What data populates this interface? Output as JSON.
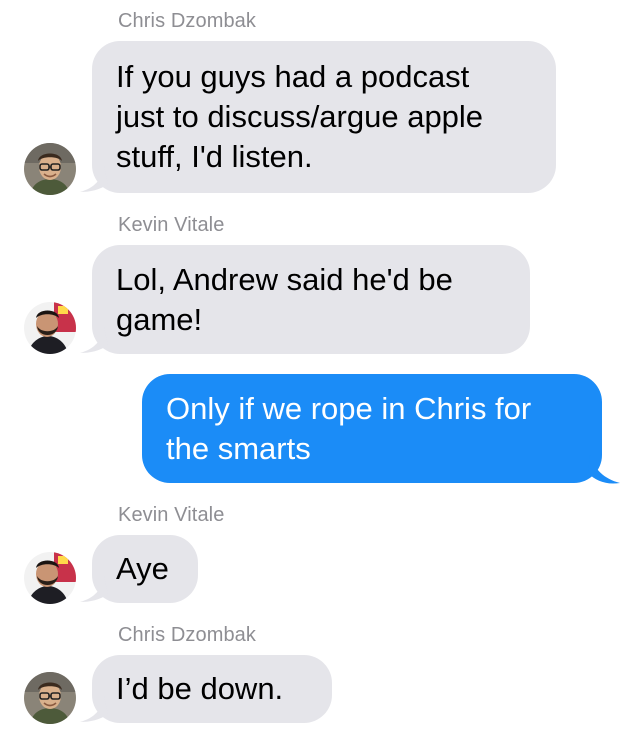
{
  "conversation": {
    "messages": [
      {
        "sender": "Chris Dzombak",
        "direction": "incoming",
        "avatar": "chris-avatar",
        "text": "If you guys had a podcast\njust to discuss/argue apple\nstuff, I'd listen."
      },
      {
        "sender": "Kevin Vitale",
        "direction": "incoming",
        "avatar": "kevin-avatar",
        "text": "Lol, Andrew said he'd be\ngame!"
      },
      {
        "sender": "",
        "direction": "outgoing",
        "text": "Only if we rope in Chris for\nthe smarts"
      },
      {
        "sender": "Kevin Vitale",
        "direction": "incoming",
        "avatar": "kevin-avatar",
        "text": "Aye"
      },
      {
        "sender": "Chris Dzombak",
        "direction": "incoming",
        "avatar": "chris-avatar",
        "text": "I’d be down."
      }
    ]
  },
  "colors": {
    "incoming_bubble": "#e5e5ea",
    "outgoing_bubble": "#1b8cf7",
    "sender_name": "#8e8e93"
  }
}
